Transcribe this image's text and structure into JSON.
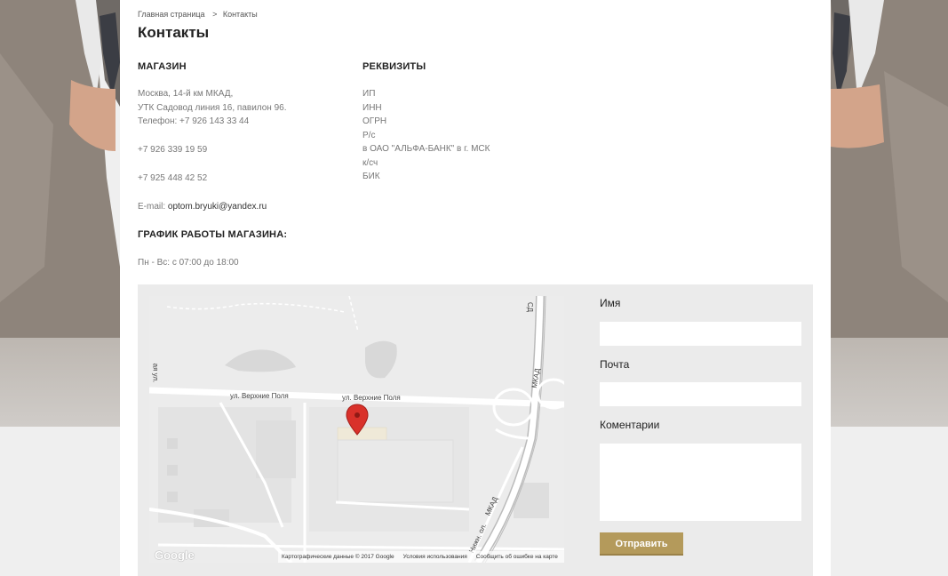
{
  "breadcrumb": {
    "home": "Главная страница",
    "separator": ">",
    "current": "Контакты"
  },
  "page": {
    "title": "Контакты"
  },
  "store": {
    "title": "МАГАЗИН",
    "address_line1": "Москва, 14-й км МКАД,",
    "address_line2": "УТК Садовод линия 16, павилон 96.",
    "phone1": "Телефон: +7 926 143 33 44",
    "phone2": "+7 926 339 19 59",
    "phone3": "+7 925 448 42 52",
    "email_label": "E-mail:",
    "email": "optom.bryuki@yandex.ru"
  },
  "requisites": {
    "title": "РЕКВИЗИТЫ",
    "lines": [
      "ИП",
      "ИНН",
      "ОГРН",
      "Р/с",
      "в ОАО \"АЛЬФА-БАНК\" в г. МСК",
      "к/сч",
      "БИК"
    ]
  },
  "schedule": {
    "title": "ГРАФИК РАБОТЫ МАГАЗИНА:",
    "hours": "Пн - Вс: с 07:00 до 18:00"
  },
  "map": {
    "street1": "ул. Верхние Поля",
    "street2": "ул. Верхние Поля",
    "road_mkad1": "МКАД",
    "road_mkad2": "МКАД",
    "road_sd": "СД",
    "road_left": "ая ул.",
    "road_bottom": "Нижн. ол.",
    "logo": "Google",
    "footer_data": "Картографические данные © 2017 Google",
    "footer_terms": "Условия использования",
    "footer_report": "Сообщить об ошибке на карте",
    "colors": {
      "background": "#ececec",
      "road": "#ffffff",
      "marker": "#d9312a"
    }
  },
  "form": {
    "name_label": "Имя",
    "email_label": "Почта",
    "comment_label": "Коментарии",
    "submit_label": "Отправить",
    "colors": {
      "button": "#b49a5b"
    }
  }
}
